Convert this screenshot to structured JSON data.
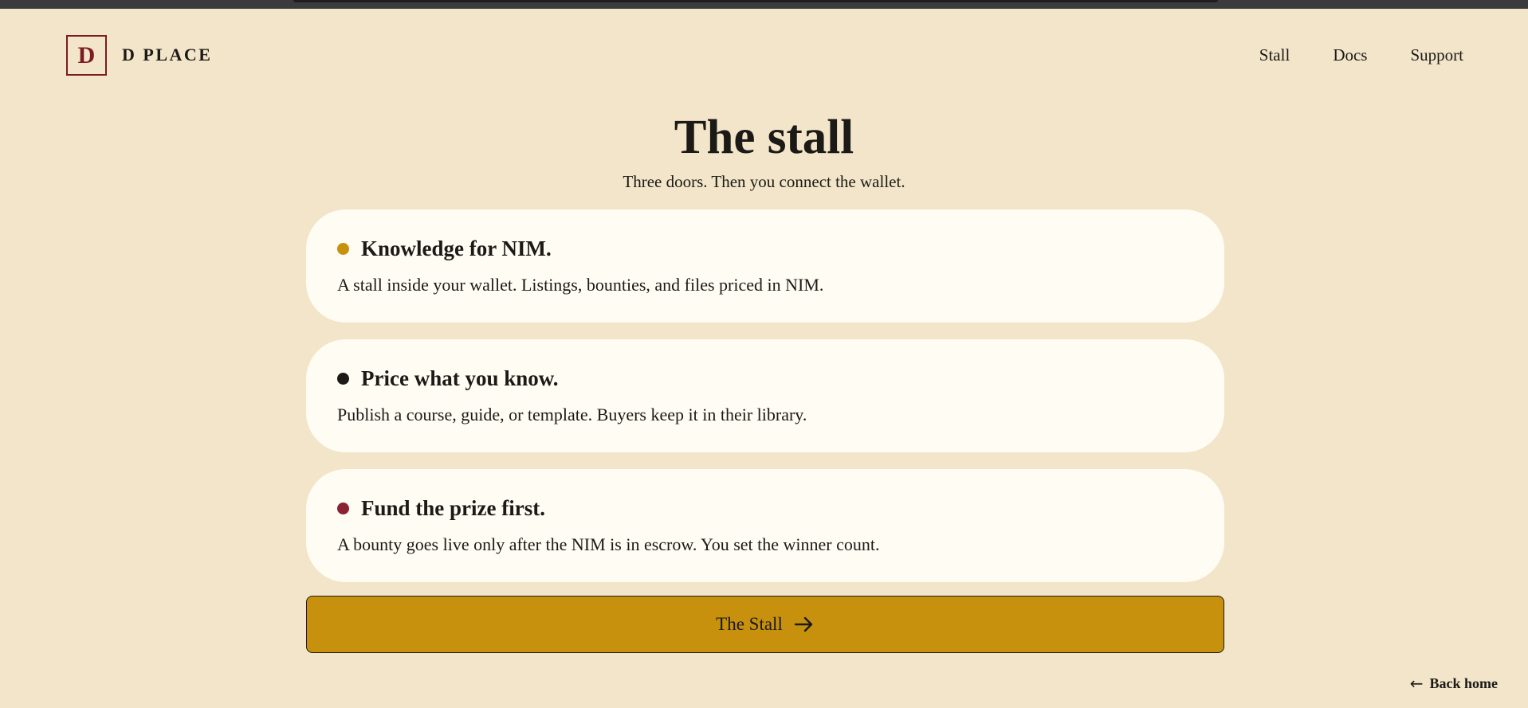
{
  "brand": {
    "logo_letter": "D",
    "name": "D PLACE"
  },
  "nav": {
    "items": [
      {
        "label": "Stall"
      },
      {
        "label": "Docs"
      },
      {
        "label": "Support"
      }
    ]
  },
  "hero": {
    "title": "The stall",
    "subtitle": "Three doors. Then you connect the wallet."
  },
  "cards": [
    {
      "title": "Knowledge for NIM.",
      "body": "A stall inside your wallet. Listings, bounties, and files priced in NIM.",
      "dot_color": "#c8910d"
    },
    {
      "title": "Price what you know.",
      "body": "Publish a course, guide, or template. Buyers keep it in their library.",
      "dot_color": "#1c1a16"
    },
    {
      "title": "Fund the prize first.",
      "body": "A bounty goes live only after the NIM is in escrow. You set the winner count.",
      "dot_color": "#8b2232"
    }
  ],
  "cta": {
    "label": "The Stall",
    "icon": "arrow-right-icon"
  },
  "footer": {
    "back_label": "Back home",
    "back_icon": "arrow-left-icon"
  },
  "colors": {
    "background": "#f2e5c9",
    "card": "#fffcf3",
    "accent": "#c8910d",
    "brand": "#7b1c24"
  }
}
